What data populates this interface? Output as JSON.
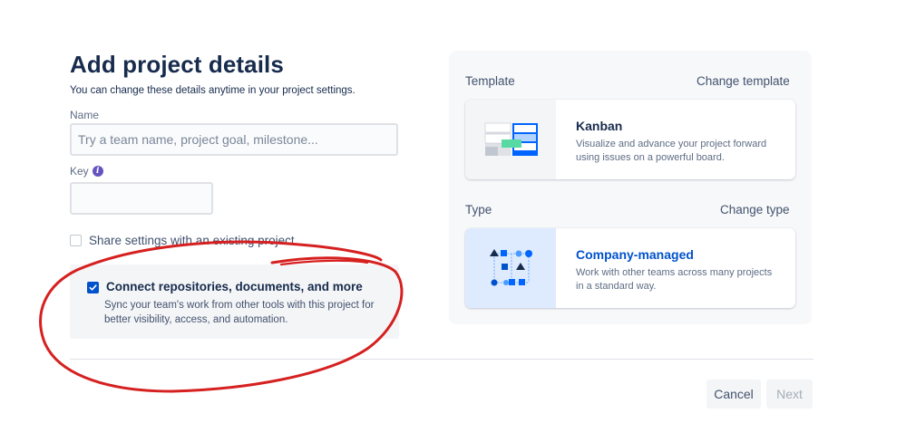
{
  "form": {
    "title": "Add project details",
    "subtitle": "You can change these details anytime in your project settings.",
    "name_label": "Name",
    "name_placeholder": "Try a team name, project goal, milestone...",
    "name_value": "",
    "key_label": "Key",
    "key_value": "",
    "share_label": "Share settings with an existing project",
    "share_checked": false,
    "connect_title": "Connect repositories, documents, and more",
    "connect_desc": "Sync your team's work from other tools with this project for better visibility, access, and automation.",
    "connect_checked": true
  },
  "template": {
    "section_label": "Template",
    "change_label": "Change template",
    "name": "Kanban",
    "description": "Visualize and advance your project forward using issues on a powerful board."
  },
  "type": {
    "section_label": "Type",
    "change_label": "Change type",
    "name": "Company-managed",
    "description": "Work with other teams across many projects in a standard way."
  },
  "footer": {
    "cancel_label": "Cancel",
    "next_label": "Next"
  },
  "colors": {
    "primary": "#0052cc",
    "text": "#172b4d",
    "annotation": "#d62020",
    "info": "#6554c0"
  }
}
